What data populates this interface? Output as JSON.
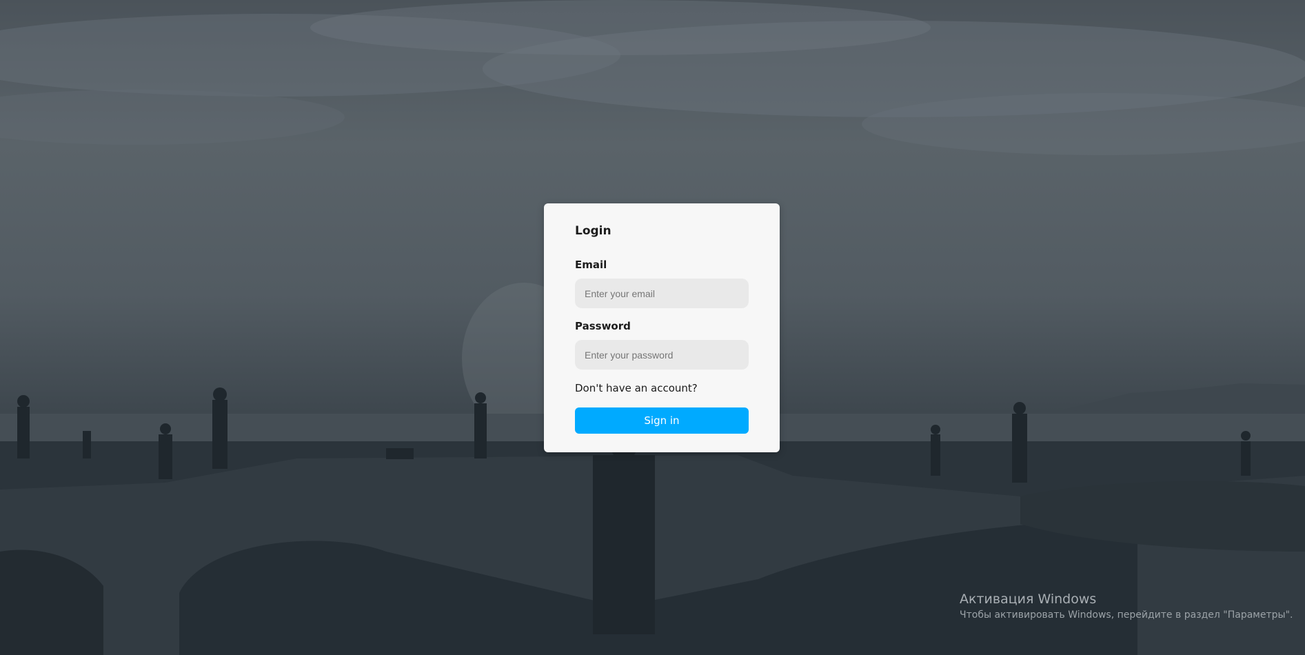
{
  "login": {
    "title": "Login",
    "email_label": "Email",
    "email_placeholder": "Enter your email",
    "email_value": "",
    "password_label": "Password",
    "password_placeholder": "Enter your password",
    "password_value": "",
    "signup_link": "Don't have an account?",
    "signin_label": "Sign in"
  },
  "windows_watermark": {
    "title": "Активация Windows",
    "message": "Чтобы активировать Windows, перейдите в раздел \"Параметры\"."
  },
  "colors": {
    "accent": "#00aaff",
    "card_background": "#f7f7f7",
    "input_background": "#e9e9e9",
    "overlay": "#3a434a"
  }
}
